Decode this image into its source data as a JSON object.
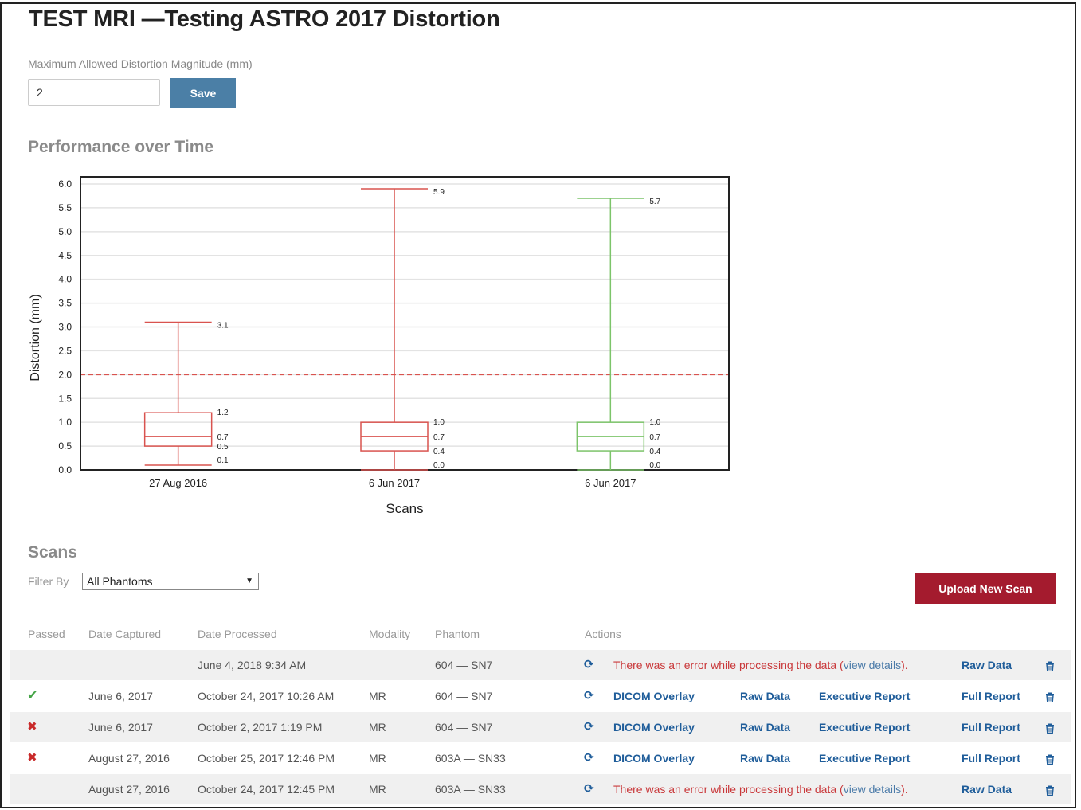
{
  "page": {
    "title": "TEST MRI —Testing ASTRO 2017 Distortion"
  },
  "distortion_setting": {
    "label": "Maximum Allowed Distortion Magnitude (mm)",
    "value": "2",
    "save_label": "Save"
  },
  "performance": {
    "heading": "Performance over Time"
  },
  "chart_data": {
    "type": "box",
    "xlabel": "Scans",
    "ylabel": "Distortion (mm)",
    "ylim": [
      0,
      6
    ],
    "y_ticks": [
      "0.0",
      "0.5",
      "1.0",
      "1.5",
      "2.0",
      "2.5",
      "3.0",
      "3.5",
      "4.0",
      "4.5",
      "5.0",
      "5.5",
      "6.0"
    ],
    "grid": true,
    "threshold": 2.0,
    "threshold_color": "#d9534f",
    "boxes": [
      {
        "category": "27 Aug 2016",
        "min": 0.1,
        "q1": 0.5,
        "median": 0.7,
        "q3": 1.2,
        "max": 3.1,
        "color": "#d9534f",
        "labels": {
          "max": "3.1",
          "q3": "1.2",
          "median": "0.7",
          "q1": "0.5",
          "min": "0.1"
        }
      },
      {
        "category": "6 Jun 2017",
        "min": 0.0,
        "q1": 0.4,
        "median": 0.7,
        "q3": 1.0,
        "max": 5.9,
        "color": "#d9534f",
        "labels": {
          "max": "5.9",
          "q3": "1.0",
          "median": "0.7",
          "q1": "0.4",
          "min": "0.0"
        }
      },
      {
        "category": "6 Jun 2017",
        "min": 0.0,
        "q1": 0.4,
        "median": 0.7,
        "q3": 1.0,
        "max": 5.7,
        "color": "#7cc46a",
        "labels": {
          "max": "5.7",
          "q3": "1.0",
          "median": "0.7",
          "q1": "0.4",
          "min": "0.0"
        }
      }
    ]
  },
  "scans": {
    "heading": "Scans",
    "filter_label": "Filter By",
    "filter_value": "All Phantoms",
    "upload_label": "Upload New Scan",
    "columns": [
      "Passed",
      "Date Captured",
      "Date Processed",
      "Modality",
      "Phantom",
      "Actions"
    ],
    "error_text": "There was an error while processing the data (",
    "error_link": "view details",
    "error_end": ").",
    "rows": [
      {
        "status": "none",
        "captured": "",
        "processed": "June 4, 2018 9:34 AM",
        "modality": "",
        "phantom": "604 — SN7",
        "error": true,
        "actions": {
          "raw": "Raw Data"
        }
      },
      {
        "status": "pass",
        "captured": "June 6, 2017",
        "processed": "October 24, 2017 10:26 AM",
        "modality": "MR",
        "phantom": "604 — SN7",
        "error": false,
        "actions": {
          "dicom": "DICOM Overlay",
          "raw": "Raw Data",
          "exec": "Executive Report",
          "full": "Full Report"
        }
      },
      {
        "status": "fail",
        "captured": "June 6, 2017",
        "processed": "October 2, 2017 1:19 PM",
        "modality": "MR",
        "phantom": "604 — SN7",
        "error": false,
        "actions": {
          "dicom": "DICOM Overlay",
          "raw": "Raw Data",
          "exec": "Executive Report",
          "full": "Full Report"
        }
      },
      {
        "status": "fail",
        "captured": "August 27, 2016",
        "processed": "October 25, 2017 12:46 PM",
        "modality": "MR",
        "phantom": "603A — SN33",
        "error": false,
        "actions": {
          "dicom": "DICOM Overlay",
          "raw": "Raw Data",
          "exec": "Executive Report",
          "full": "Full Report"
        }
      },
      {
        "status": "none",
        "captured": "August 27, 2016",
        "processed": "October 24, 2017 12:45 PM",
        "modality": "MR",
        "phantom": "603A — SN33",
        "error": true,
        "actions": {
          "raw": "Raw Data"
        }
      }
    ]
  },
  "icons": {
    "refresh": "refresh-icon",
    "trash": "trash-icon",
    "pass": "check-icon",
    "fail": "cross-icon"
  },
  "colors": {
    "save": "#4b7fa6",
    "upload": "#a41b2e",
    "link": "#1f5d9a",
    "error": "#c9383a",
    "pass": "#46a548",
    "fail": "#c92a2a"
  }
}
